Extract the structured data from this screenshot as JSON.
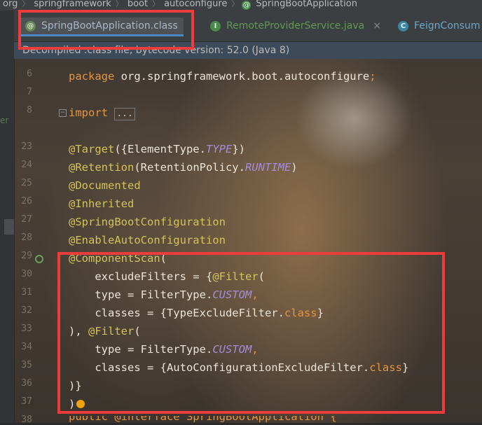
{
  "breadcrumb": {
    "items": [
      "org",
      "springframework",
      "boot",
      "autoconfigure",
      "SpringBootApplication"
    ],
    "last_icon": "@"
  },
  "tabs": [
    {
      "label": "SpringBootApplication.class",
      "icon": "@",
      "active": true
    },
    {
      "label": "RemoteProviderService.java",
      "icon": "I",
      "active": false
    },
    {
      "label": "FeignConsum",
      "icon": "C",
      "active": false
    }
  ],
  "tab_close_glyph": "×",
  "infobar": {
    "text": "Decompiled .class file, bytecode version: 52.0 (Java 8)"
  },
  "gutter": {
    "line_numbers": [
      "6",
      "7",
      "8",
      "",
      "",
      "23",
      "24",
      "25",
      "26",
      "27",
      "28",
      "29",
      "30",
      "31",
      "32",
      "33",
      "34",
      "35",
      "36",
      "37",
      "38"
    ]
  },
  "code": {
    "package_kw": "package",
    "package_name": " org.springframework.boot.autoconfigure",
    "semicolon": ";",
    "import_kw": "import",
    "import_fold": "...",
    "target_ann": "@Target",
    "target_args_pre": "({ElementType.",
    "target_const": "TYPE",
    "target_args_post": "})",
    "retention_ann": "@Retention",
    "retention_args_pre": "(RetentionPolicy.",
    "retention_const": "RUNTIME",
    "retention_args_post": ")",
    "documented": "@Documented",
    "inherited": "@Inherited",
    "sbconfig": "@SpringBootConfiguration",
    "enableauto": "@EnableAutoConfiguration",
    "componentscan": "@ComponentScan",
    "cs_paren": "(",
    "exclude_pre": "    excludeFilters = {",
    "filter_ann": "@Filter",
    "filter_paren": "(",
    "type_pre": "    type = FilterType.",
    "custom": "CUSTOM",
    "comma": ",",
    "classes1_pre": "    classes = {TypeExcludeFilter.",
    "class_kw": "class",
    "brace_close": "}",
    "filter2_pre": "), ",
    "classes2_pre": "    classes = {AutoConfigurationExcludeFilter.",
    "close_braces": ")}",
    "close_paren": ")",
    "last_line": "public @interface SpringBootApplication {"
  },
  "colors": {
    "highlight": "#ec3c3c",
    "keyword": "#e6953f",
    "annotation": "#d3c35a",
    "constant": "#a68cd8"
  }
}
